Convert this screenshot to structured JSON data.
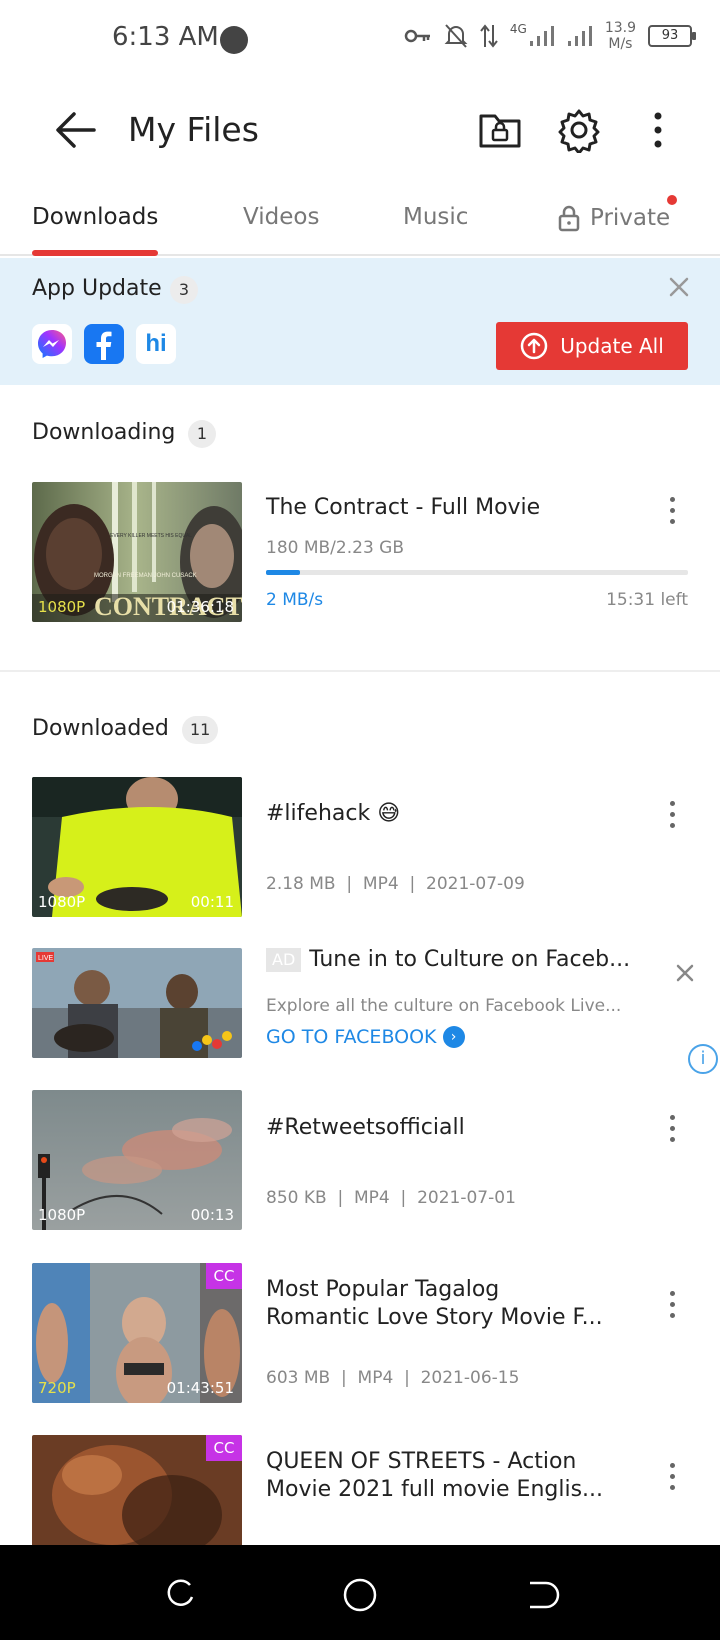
{
  "status_bar": {
    "time": "6:13 AM",
    "network": "4G",
    "speed_value": "13.9",
    "speed_unit": "M/s",
    "battery": "93"
  },
  "app_bar": {
    "title": "My Files",
    "icons": [
      "back-arrow-icon",
      "private-folder-icon",
      "gear-icon",
      "more-vertical-icon"
    ]
  },
  "tabs": [
    {
      "label": "Downloads",
      "active": true
    },
    {
      "label": "Videos",
      "active": false
    },
    {
      "label": "Music",
      "active": false
    },
    {
      "label": "Private",
      "active": false
    }
  ],
  "app_update": {
    "title": "App Update",
    "count": "3",
    "apps": [
      "messenger-icon",
      "facebook-icon",
      "hi-app-icon"
    ],
    "button_label": "Update All"
  },
  "downloading": {
    "title": "Downloading",
    "count": "1",
    "item": {
      "title": "The Contract - Full Movie",
      "size": "180 MB/2.23 GB",
      "progress": 0.08,
      "speed": "2 MB/s",
      "time_left": "15:31 left",
      "quality": "1080P",
      "duration": "01:36:18"
    }
  },
  "downloaded": {
    "title": "Downloaded",
    "count": "11",
    "items": [
      {
        "title": "#lifehack 😅",
        "title2": "",
        "meta": "2.18 MB  |  MP4  |  2021-07-09",
        "quality": "1080P",
        "duration": "00:11",
        "cc": ""
      },
      {
        "title": "#Retweetsofficiall",
        "title2": "",
        "meta": "850 KB  |  MP4  |  2021-07-01",
        "quality": "1080P",
        "duration": "00:13",
        "cc": ""
      },
      {
        "title": "Most Popular Tagalog",
        "title2": "Romantic Love Story Movie F...",
        "meta": "603 MB  |  MP4  |  2021-06-15",
        "quality": "720P",
        "duration": "01:43:51",
        "cc": "CC"
      },
      {
        "title": "QUEEN OF STREETS - Action",
        "title2": "Movie 2021 full movie Englis...",
        "meta": "",
        "quality": "",
        "duration": "",
        "cc": "CC"
      }
    ]
  },
  "ad": {
    "tag": "AD",
    "title": "Tune in to Culture on Faceb...",
    "description": "Explore all the culture on Facebook Live...",
    "cta": "GO TO FACEBOOK",
    "live_badge": "LIVE"
  },
  "thumb_texts": {
    "contract_title": "CONTRACT",
    "contract_names": "MORGAN FREEMAN  JOHN CUSACK",
    "contract_tagline": "EVERY KILLER MEETS HIS EQUAL"
  },
  "colors": {
    "accent": "#e53935",
    "link": "#1e88e5",
    "banner_bg": "#e3f1fa",
    "cc_badge": "#c633e6"
  }
}
